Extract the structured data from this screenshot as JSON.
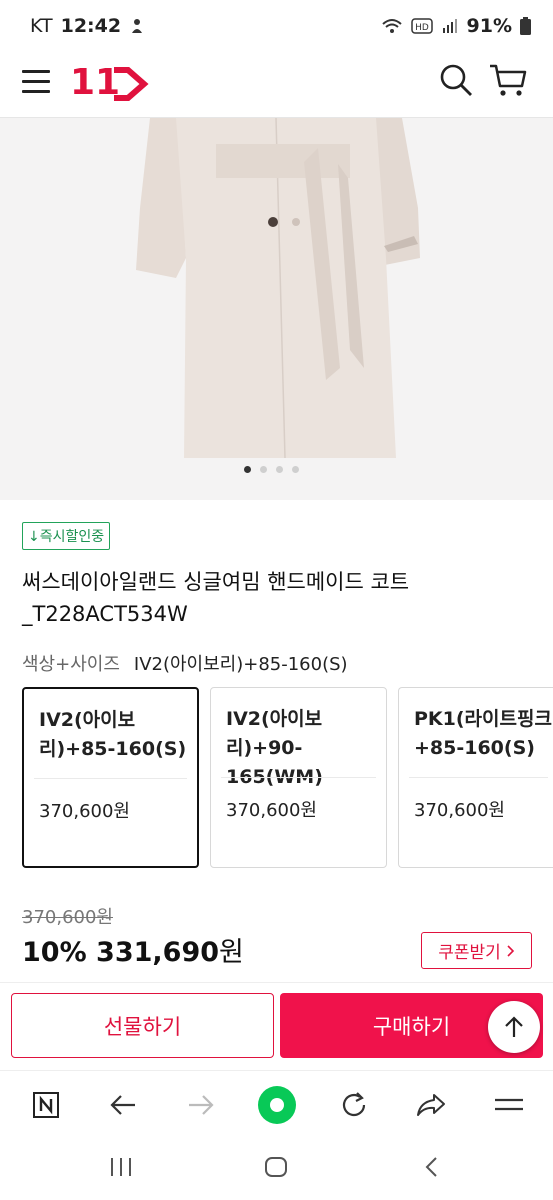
{
  "status_bar": {
    "carrier": "KT",
    "time": "12:42",
    "battery": "91%"
  },
  "header": {
    "logo_text": "11",
    "brand_color": "#e0123e"
  },
  "gallery": {
    "pages": 4,
    "active_index": 0
  },
  "product": {
    "badge": "↓즉시할인중",
    "title": "써스데이아일랜드 싱글여밈 핸드메이드 코트 _T228ACT534W",
    "option_label": "색상+사이즈",
    "option_value": "IV2(아이보리)+85-160(S)"
  },
  "options": [
    {
      "name": "IV2(아이보리)+85-160(S)",
      "price": "370,600원",
      "selected": true
    },
    {
      "name": "IV2(아이보리)+90-165(WM)",
      "price": "370,600원",
      "selected": false
    },
    {
      "name": "PK1(라이트핑크)+85-160(S)",
      "price": "370,600원",
      "selected": false
    }
  ],
  "pricing": {
    "original": "370,600원",
    "discount": "10%",
    "final_amount": "331,690",
    "final_unit": "원",
    "coupon_label": "쿠폰받기"
  },
  "actions": {
    "gift_label": "선물하기",
    "buy_label": "구매하기",
    "accent": "#f0124b"
  },
  "browser_toolbar": [
    "naver-icon",
    "back-icon",
    "forward-icon",
    "home-icon",
    "reload-icon",
    "share-icon",
    "menu-icon"
  ],
  "system_nav": [
    "recents-icon",
    "home-icon",
    "back-icon"
  ]
}
